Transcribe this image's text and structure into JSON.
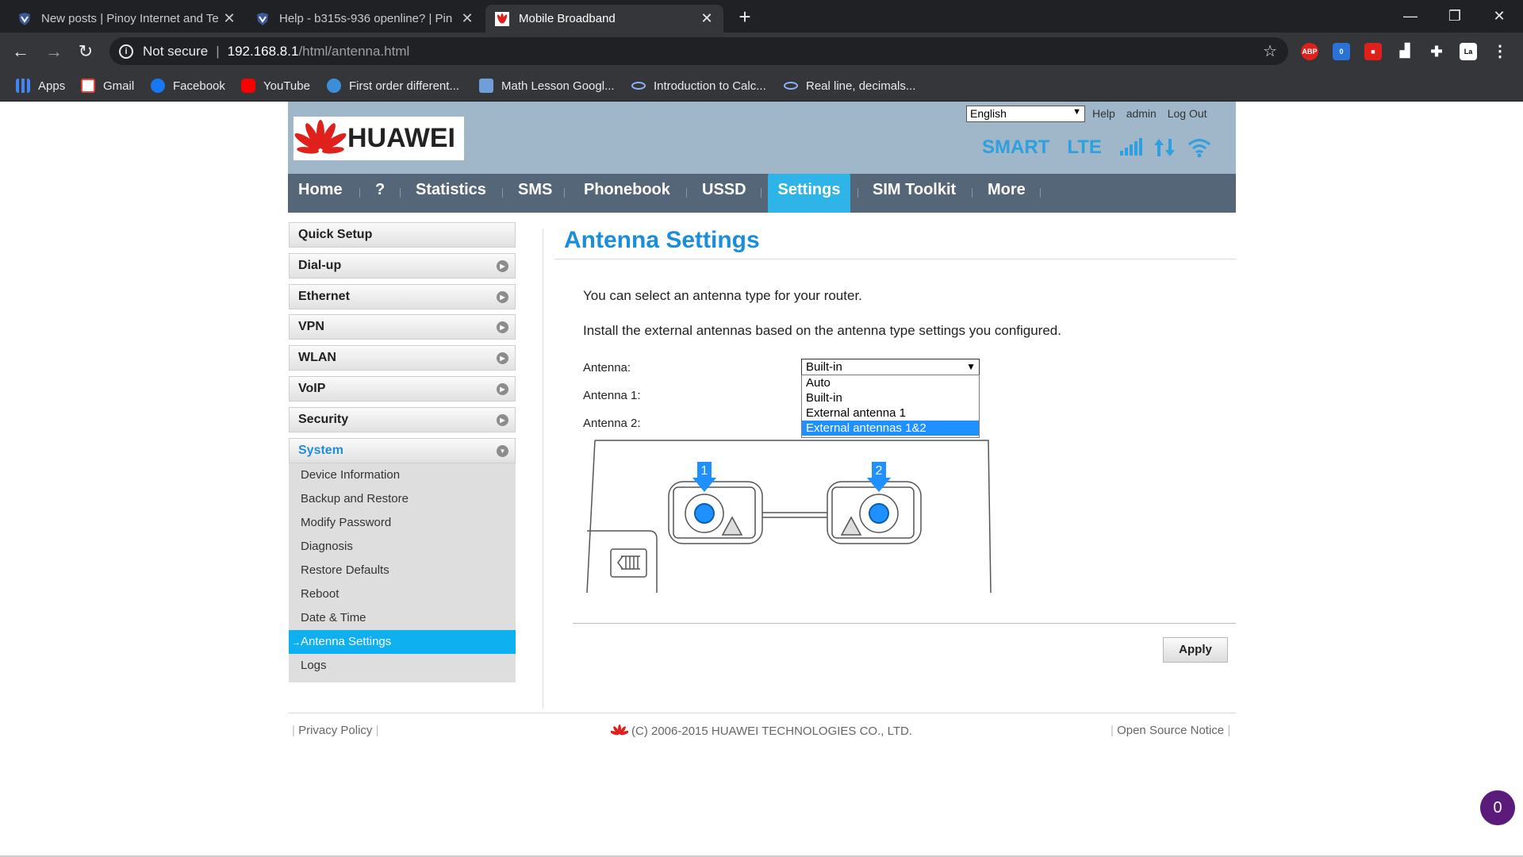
{
  "browser": {
    "tabs": [
      {
        "title": "New posts | Pinoy Internet and Te"
      },
      {
        "title": "Help - b315s-936 openline? | Pin"
      },
      {
        "title": "Mobile Broadband"
      }
    ],
    "new_tab": "+",
    "address": {
      "security": "Not secure",
      "host": "192.168.8.1",
      "path": "/html/antenna.html"
    },
    "extensions": [
      "ABP",
      "0",
      "La"
    ],
    "bookmarks": [
      {
        "label": "Apps"
      },
      {
        "label": "Gmail"
      },
      {
        "label": "Facebook"
      },
      {
        "label": "YouTube"
      },
      {
        "label": "First order different..."
      },
      {
        "label": "Math Lesson Googl..."
      },
      {
        "label": "Introduction to Calc..."
      },
      {
        "label": "Real line, decimals..."
      }
    ]
  },
  "header": {
    "brand": "HUAWEI",
    "language": "English",
    "links": {
      "help": "Help",
      "user": "admin",
      "logout": "Log Out"
    },
    "operator": "SMART",
    "network": "LTE"
  },
  "nav": {
    "items": [
      "Home",
      "?",
      "Statistics",
      "SMS",
      "Phonebook",
      "USSD",
      "Settings",
      "SIM Toolkit",
      "More"
    ],
    "active": "Settings"
  },
  "sidebar": {
    "items": [
      "Quick Setup",
      "Dial-up",
      "Ethernet",
      "VPN",
      "WLAN",
      "VoIP",
      "Security",
      "System"
    ],
    "system_sub": [
      "Device Information",
      "Backup and Restore",
      "Modify Password",
      "Diagnosis",
      "Restore Defaults",
      "Reboot",
      "Date & Time",
      "Antenna Settings",
      "Logs"
    ],
    "active_sub": "Antenna Settings"
  },
  "content": {
    "title": "Antenna Settings",
    "intro1": "You can select an antenna type for your router.",
    "intro2": "Install the external antennas based on the antenna type settings you configured.",
    "antenna_label": "Antenna:",
    "antenna1_label": "Antenna 1:",
    "antenna2_label": "Antenna 2:",
    "antenna_value": "Built-in",
    "antenna_options": [
      "Auto",
      "Built-in",
      "External antenna 1",
      "External antennas 1&2"
    ],
    "highlighted_option": "External antennas 1&2",
    "port1": "1",
    "port2": "2",
    "apply": "Apply"
  },
  "footer": {
    "privacy": "Privacy Policy",
    "copyright": "(C) 2006-2015 HUAWEI TECHNOLOGIES CO., LTD.",
    "open_source": "Open Source Notice"
  },
  "fab_count": "0",
  "colors": {
    "accent": "#2fb4e8",
    "title_blue": "#1a8ddb",
    "nav_bg": "#546677",
    "header_bg": "#9fb7c8",
    "huawei_red": "#e0201a"
  }
}
